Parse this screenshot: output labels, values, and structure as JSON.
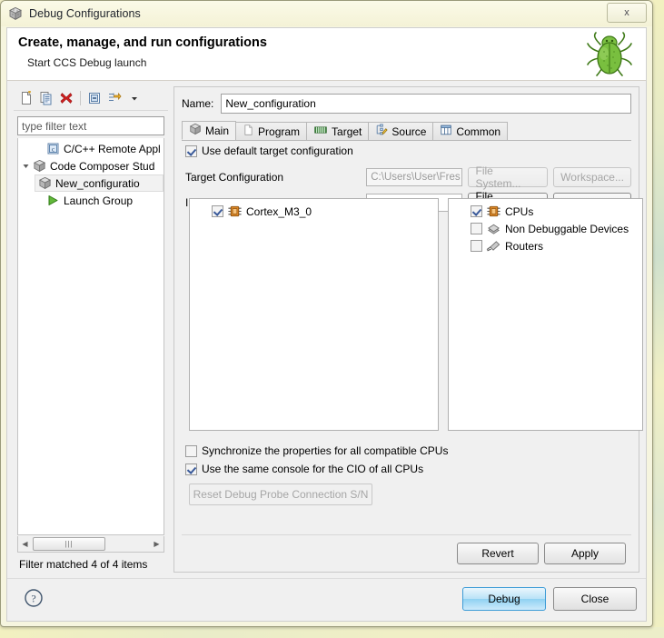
{
  "window": {
    "title": "Debug Configurations",
    "title_icon": "ccs-cube-icon",
    "close_label": "x"
  },
  "banner": {
    "heading": "Create, manage, and run configurations",
    "subheading": "Start CCS Debug launch",
    "icon": "green-bug-icon"
  },
  "sidebar": {
    "toolbar": [
      {
        "name": "new-configuration-icon",
        "label": "New launch configuration"
      },
      {
        "name": "duplicate-icon",
        "label": "Duplicate"
      },
      {
        "name": "delete-icon",
        "label": "Delete"
      },
      {
        "name": "collapse-all-icon",
        "label": "Collapse All"
      },
      {
        "name": "filter-icon",
        "label": "Filter"
      },
      {
        "name": "chevron-down-icon",
        "label": "Menu"
      }
    ],
    "filter_placeholder": "type filter text",
    "tree": [
      {
        "label": "C/C++ Remote Appl",
        "icon": "c-file-icon",
        "indent": 1,
        "expander": "",
        "selected": false
      },
      {
        "label": "Code Composer Stud",
        "icon": "ccs-cube-icon",
        "indent": 1,
        "expander": "expanded",
        "selected": false
      },
      {
        "label": "New_configuratio",
        "icon": "ccs-cube-icon",
        "indent": 2,
        "expander": "",
        "selected": true
      },
      {
        "label": "Launch Group",
        "icon": "green-play-icon",
        "indent": 1,
        "expander": "",
        "selected": false
      }
    ],
    "scroll_left_arrow": "◀",
    "scroll_right_arrow": "▶",
    "scroll_thumb_grip": "|||",
    "status": "Filter matched 4 of 4 items"
  },
  "main": {
    "name_label": "Name:",
    "name_value": "New_configuration",
    "tabs": [
      {
        "label": "Main",
        "icon": "ccs-cube-icon",
        "active": true
      },
      {
        "label": "Program",
        "icon": "page-icon",
        "active": false
      },
      {
        "label": "Target",
        "icon": "chip-icon",
        "active": false
      },
      {
        "label": "Source",
        "icon": "source-pencil-icon",
        "active": false
      },
      {
        "label": "Common",
        "icon": "table-icon",
        "active": false
      }
    ],
    "use_default_target": {
      "label": "Use default target configuration",
      "checked": true
    },
    "fields": [
      {
        "label": "Target Configuration",
        "value": "C:\\Users\\User\\Fres",
        "placeholder": "",
        "disabled": true,
        "buttons": [
          {
            "label": "File System...",
            "disabled": true
          },
          {
            "label": "Workspace...",
            "disabled": true
          }
        ]
      },
      {
        "label": "Initialization Script",
        "value": "",
        "placeholder": "",
        "disabled": false,
        "buttons": [
          {
            "label": "File System...",
            "disabled": false
          },
          {
            "label": "Workspace...",
            "disabled": false
          }
        ]
      }
    ],
    "left_list": [
      {
        "label": "Cortex_M3_0",
        "icon": "cpu-chip-icon",
        "checked": true
      }
    ],
    "right_list": [
      {
        "label": "CPUs",
        "icon": "cpu-chip-icon",
        "checked": true
      },
      {
        "label": "Non Debuggable Devices",
        "icon": "devices-icon",
        "checked": false
      },
      {
        "label": "Routers",
        "icon": "router-icon",
        "checked": false
      }
    ],
    "options": [
      {
        "label": "Synchronize the properties for all compatible CPUs",
        "checked": false
      },
      {
        "label": "Use the same console for the CIO of all CPUs",
        "checked": true
      }
    ],
    "reset_button": {
      "label": "Reset Debug Probe Connection S/N",
      "disabled": true
    },
    "revert_button": {
      "label": "Revert"
    },
    "apply_button": {
      "label": "Apply"
    }
  },
  "footer": {
    "help_icon": "help-question-icon",
    "debug_button": "Debug",
    "close_button": "Close"
  },
  "colors": {
    "titlebar": "#f6f4dd",
    "accent_blue": "#8fd2f2",
    "bug_green": "#6cb03a",
    "cpu_orange": "#e08a28",
    "delete_red": "#d32020"
  }
}
